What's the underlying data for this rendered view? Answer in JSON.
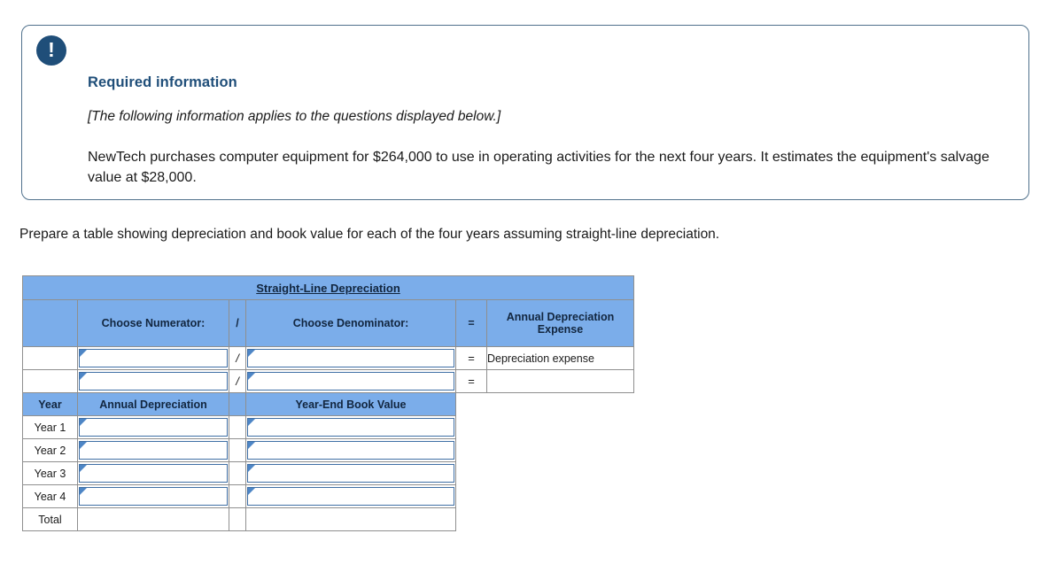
{
  "alert": {
    "icon": "exclamation-icon",
    "title": "Required information",
    "subtitle": "[The following information applies to the questions displayed below.]",
    "body": "NewTech purchases computer equipment for $264,000 to use in operating activities for the next four years. It estimates the equipment's salvage value at $28,000.",
    "border_color": "#50718c",
    "accent_color": "#1f4e79"
  },
  "prompt": "Prepare a table showing depreciation and book value for each of the four years assuming straight-line depreciation.",
  "table": {
    "title": "Straight-Line Depreciation",
    "header_color": "#7badea",
    "headers": {
      "numerator": "Choose Numerator:",
      "divide": "/",
      "denominator": "Choose Denominator:",
      "equals": "=",
      "result": "Annual Depreciation Expense"
    },
    "formula_rows": [
      {
        "numerator": "",
        "divide": "/",
        "denominator": "",
        "equals": "=",
        "result": "Depreciation expense",
        "result_is_input": false
      },
      {
        "numerator": "",
        "divide": "/",
        "denominator": "",
        "equals": "=",
        "result": "",
        "result_is_input": false
      }
    ],
    "schedule_headers": {
      "year": "Year",
      "annual_depreciation": "Annual Depreciation",
      "spacer": "",
      "book_value": "Year-End Book Value"
    },
    "schedule_rows": [
      {
        "year": "Year 1",
        "annual_depreciation": "",
        "book_value": "",
        "is_input": true
      },
      {
        "year": "Year 2",
        "annual_depreciation": "",
        "book_value": "",
        "is_input": true
      },
      {
        "year": "Year 3",
        "annual_depreciation": "",
        "book_value": "",
        "is_input": true
      },
      {
        "year": "Year 4",
        "annual_depreciation": "",
        "book_value": "",
        "is_input": true
      },
      {
        "year": "Total",
        "annual_depreciation": "",
        "book_value": "",
        "is_input": false
      }
    ]
  }
}
